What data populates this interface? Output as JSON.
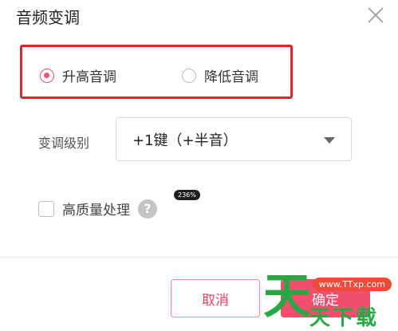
{
  "dialog": {
    "title": "音频变调"
  },
  "pitch_direction": {
    "options": [
      {
        "label": "升高音调",
        "selected": true
      },
      {
        "label": "降低音调",
        "selected": false
      }
    ]
  },
  "level": {
    "label": "变调级别",
    "selected_value": "+1键（+半音）"
  },
  "quality": {
    "label": "高质量处理",
    "checked": false,
    "help_glyph": "?"
  },
  "zoom_badge": "236%",
  "buttons": {
    "cancel": "取消",
    "ok": "确定"
  },
  "watermark": {
    "url": "www.TTxp.com",
    "big": "天",
    "small": "天下载"
  },
  "colors": {
    "accent": "#f0506e",
    "highlight_border": "#e8202a",
    "watermark_green": "#28a745",
    "watermark_badge": "#f04a3a"
  },
  "icons": {
    "close": "close-icon",
    "dropdown": "chevron-down-icon",
    "help": "question-circle-icon"
  }
}
